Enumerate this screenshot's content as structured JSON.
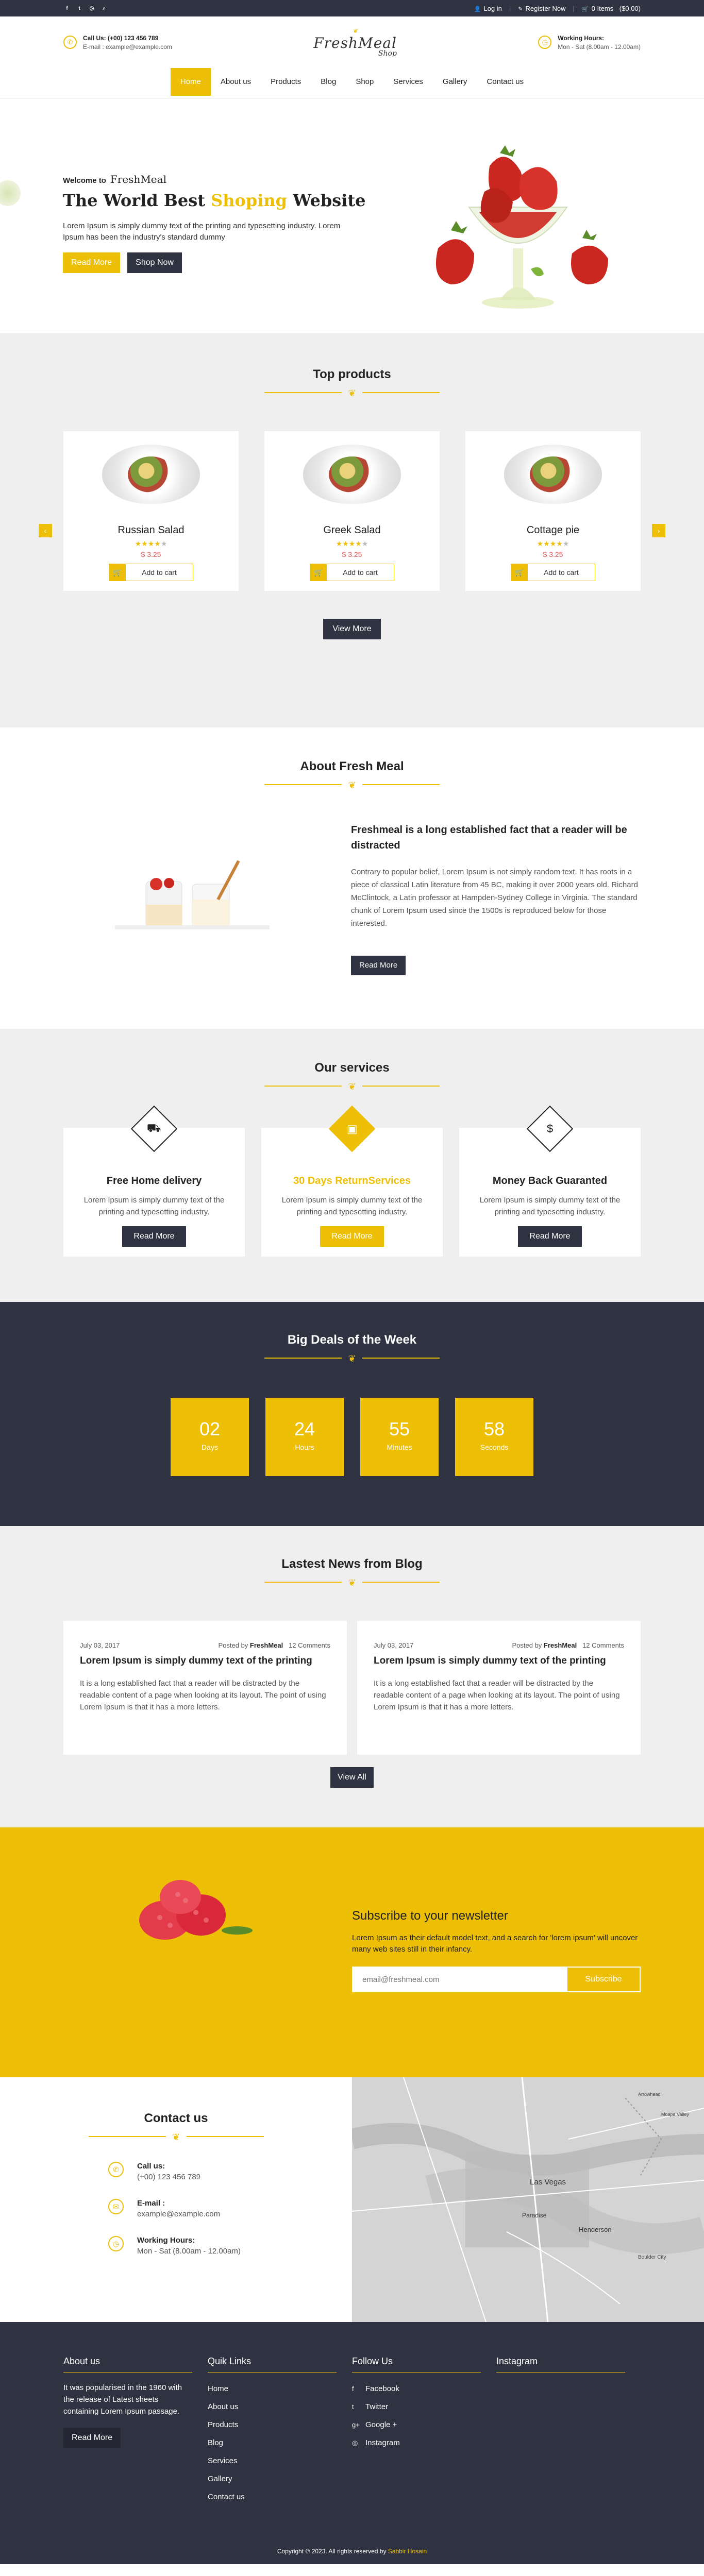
{
  "topbar": {
    "social": [
      {
        "icon": "facebook-icon",
        "glyph": "f"
      },
      {
        "icon": "twitter-icon",
        "glyph": "t"
      },
      {
        "icon": "instagram-icon",
        "glyph": "◎"
      },
      {
        "icon": "search-icon",
        "glyph": "⌕"
      }
    ],
    "login": "Log in",
    "register": "Register Now",
    "cart": "0 Items - ($0.00)"
  },
  "header": {
    "call_title": "Call Us: (+00) 123 456 789",
    "call_email": "E-mail : example@example.com",
    "logo_main": "FreshMeal",
    "logo_sub": "Shop",
    "hours_title": "Working Hours:",
    "hours_value": "Mon - Sat (8.00am - 12.00am)"
  },
  "nav": [
    "Home",
    "About us",
    "Products",
    "Blog",
    "Shop",
    "Services",
    "Gallery",
    "Contact us"
  ],
  "hero": {
    "welcome": "Welcome to",
    "brand": "FreshMeal",
    "title_a": "The World Best ",
    "title_hl": "Shoping",
    "title_b": " Website",
    "text": "Lorem Ipsum is simply dummy text of the printing and typesetting industry. Lorem Ipsum has been the industry's standard dummy",
    "btn_read": "Read More",
    "btn_shop": "Shop Now"
  },
  "products": {
    "title": "Top products",
    "items": [
      {
        "name": "Russian Salad",
        "price": "$ 3.25",
        "stars": 4
      },
      {
        "name": "Greek Salad",
        "price": "$ 3.25",
        "stars": 4
      },
      {
        "name": "Cottage pie",
        "price": "$ 3.25",
        "stars": 4
      }
    ],
    "add_label": "Add to cart",
    "view_more": "View More"
  },
  "about": {
    "title": "About Fresh Meal",
    "heading": "Freshmeal is a long established fact that a reader will be distracted",
    "text": "Contrary to popular belief, Lorem Ipsum is not simply random text. It has roots in a piece of classical Latin literature from 45 BC, making it over 2000 years old. Richard McClintock, a Latin professor at Hampden-Sydney College in Virginia. The standard chunk of Lorem Ipsum used since the 1500s is reproduced below for those interested.",
    "btn": "Read More"
  },
  "services": {
    "title": "Our services",
    "items": [
      {
        "name": "Free Home delivery",
        "icon": "truck-icon",
        "glyph": "⛟",
        "text": "Lorem Ipsum is simply dummy text of the printing and typesetting industry.",
        "btn": "Read More"
      },
      {
        "name": "30 Days ReturnServices",
        "icon": "briefcase-icon",
        "glyph": "▣",
        "text": "Lorem Ipsum is simply dummy text of the printing and typesetting industry.",
        "btn": "Read More"
      },
      {
        "name": "Money Back Guaranted",
        "icon": "dollar-icon",
        "glyph": "$",
        "text": "Lorem Ipsum is simply dummy text of the printing and typesetting industry.",
        "btn": "Read More"
      }
    ]
  },
  "deals": {
    "title": "Big Deals of the Week",
    "counters": [
      {
        "value": "02",
        "label": "Days"
      },
      {
        "value": "24",
        "label": "Hours"
      },
      {
        "value": "55",
        "label": "Minutes"
      },
      {
        "value": "58",
        "label": "Seconds"
      }
    ]
  },
  "blog": {
    "title": "Lastest News from Blog",
    "posts": [
      {
        "date": "July 03, 2017",
        "by": "Posted by ",
        "author": "FreshMeal",
        "comments": "12 Comments",
        "title": "Lorem Ipsum is simply dummy text of the printing",
        "text": "It is a long established fact that a reader will be distracted by the readable content of a page when looking at its layout. The point of using Lorem Ipsum is that it has a more letters."
      },
      {
        "date": "July 03, 2017",
        "by": "Posted by ",
        "author": "FreshMeal",
        "comments": "12 Comments",
        "title": "Lorem Ipsum is simply dummy text of the printing",
        "text": "It is a long established fact that a reader will be distracted by the readable content of a page when looking at its layout. The point of using Lorem Ipsum is that it has a more letters."
      }
    ],
    "view_all": "View All"
  },
  "newsletter": {
    "title": "Subscribe to your newsletter",
    "text": "Lorem Ipsum as their default model text, and a search for 'lorem ipsum' will uncover many web sites still in their infancy.",
    "placeholder": "email@freshmeal.com",
    "btn": "Subscribe"
  },
  "contact": {
    "title": "Contact us",
    "items": [
      {
        "icon": "phone-icon",
        "glyph": "✆",
        "label": "Call us:",
        "value": "(+00) 123 456 789"
      },
      {
        "icon": "mail-icon",
        "glyph": "✉",
        "label": "E-mail :",
        "value": "example@example.com"
      },
      {
        "icon": "clock-icon",
        "glyph": "◷",
        "label": "Working Hours:",
        "value": "Mon - Sat (8.00am - 12.00am)"
      }
    ],
    "map_labels": [
      "Las Vegas",
      "Paradise",
      "Henderson",
      "Boulder City",
      "Arrowhead",
      "Moapa Valley"
    ]
  },
  "footer": {
    "about_title": "About us",
    "about_text": "It was popularised in the 1960 with the release of Latest sheets containing Lorem Ipsum passage.",
    "about_btn": "Read More",
    "links_title": "Quik Links",
    "links": [
      "Home",
      "About us",
      "Products",
      "Blog",
      "Services",
      "Gallery",
      "Contact us"
    ],
    "follow_title": "Follow Us",
    "follow": [
      {
        "glyph": "f",
        "name": "Facebook"
      },
      {
        "glyph": "t",
        "name": "Twitter"
      },
      {
        "glyph": "g+",
        "name": "Google +"
      },
      {
        "glyph": "◎",
        "name": "Instagram"
      }
    ],
    "insta_title": "Instagram",
    "copyright": "Copyright © 2023. All rights reserved by ",
    "copyright_name": "Sabbir Hosain"
  },
  "colors": {
    "accent": "#edbf07",
    "dark": "#2f3241",
    "price": "#d9534f",
    "light": "#efefef"
  }
}
